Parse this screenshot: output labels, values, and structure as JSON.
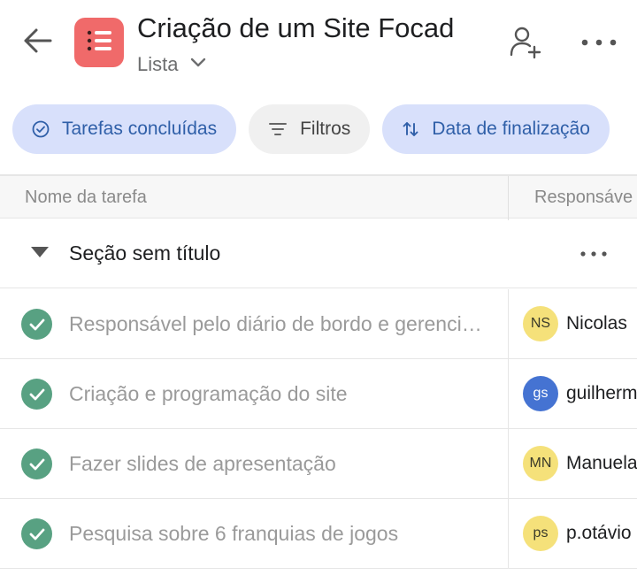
{
  "header": {
    "title": "Criação de um Site Focad",
    "view_label": "Lista",
    "icons": {
      "back": "arrow-left-icon",
      "project": "list-icon",
      "view_dropdown": "chevron-down-icon",
      "add_member": "add-person-icon",
      "more": "more-horizontal-icon"
    },
    "project_color": "#f06a6a"
  },
  "filters": {
    "completed_tasks": "Tarefas concluídas",
    "filters": "Filtros",
    "sort": "Data de finalização"
  },
  "table": {
    "columns": [
      "Nome da tarefa",
      "Responsáve"
    ]
  },
  "section": {
    "title": "Seção sem título"
  },
  "tasks": [
    {
      "name": "Responsável pelo diário de bordo e gerenciamento",
      "assignee_initials": "NS",
      "assignee_name": "Nicolas",
      "avatar_color": "#f5e17a",
      "completed": true
    },
    {
      "name": "Criação e programação do site",
      "assignee_initials": "gs",
      "assignee_name": "guilherm",
      "avatar_color": "#4573d2",
      "completed": true
    },
    {
      "name": "Fazer slides de apresentação",
      "assignee_initials": "MN",
      "assignee_name": "Manuela",
      "avatar_color": "#f5e17a",
      "completed": true
    },
    {
      "name": "Pesquisa sobre 6 franquias de jogos",
      "assignee_initials": "ps",
      "assignee_name": "p.otávio",
      "avatar_color": "#f5e17a",
      "completed": true
    }
  ],
  "colors": {
    "accent_chip_bg": "#d8e0fb",
    "accent_chip_text": "#2f5fa8",
    "complete_green": "#58a182"
  }
}
